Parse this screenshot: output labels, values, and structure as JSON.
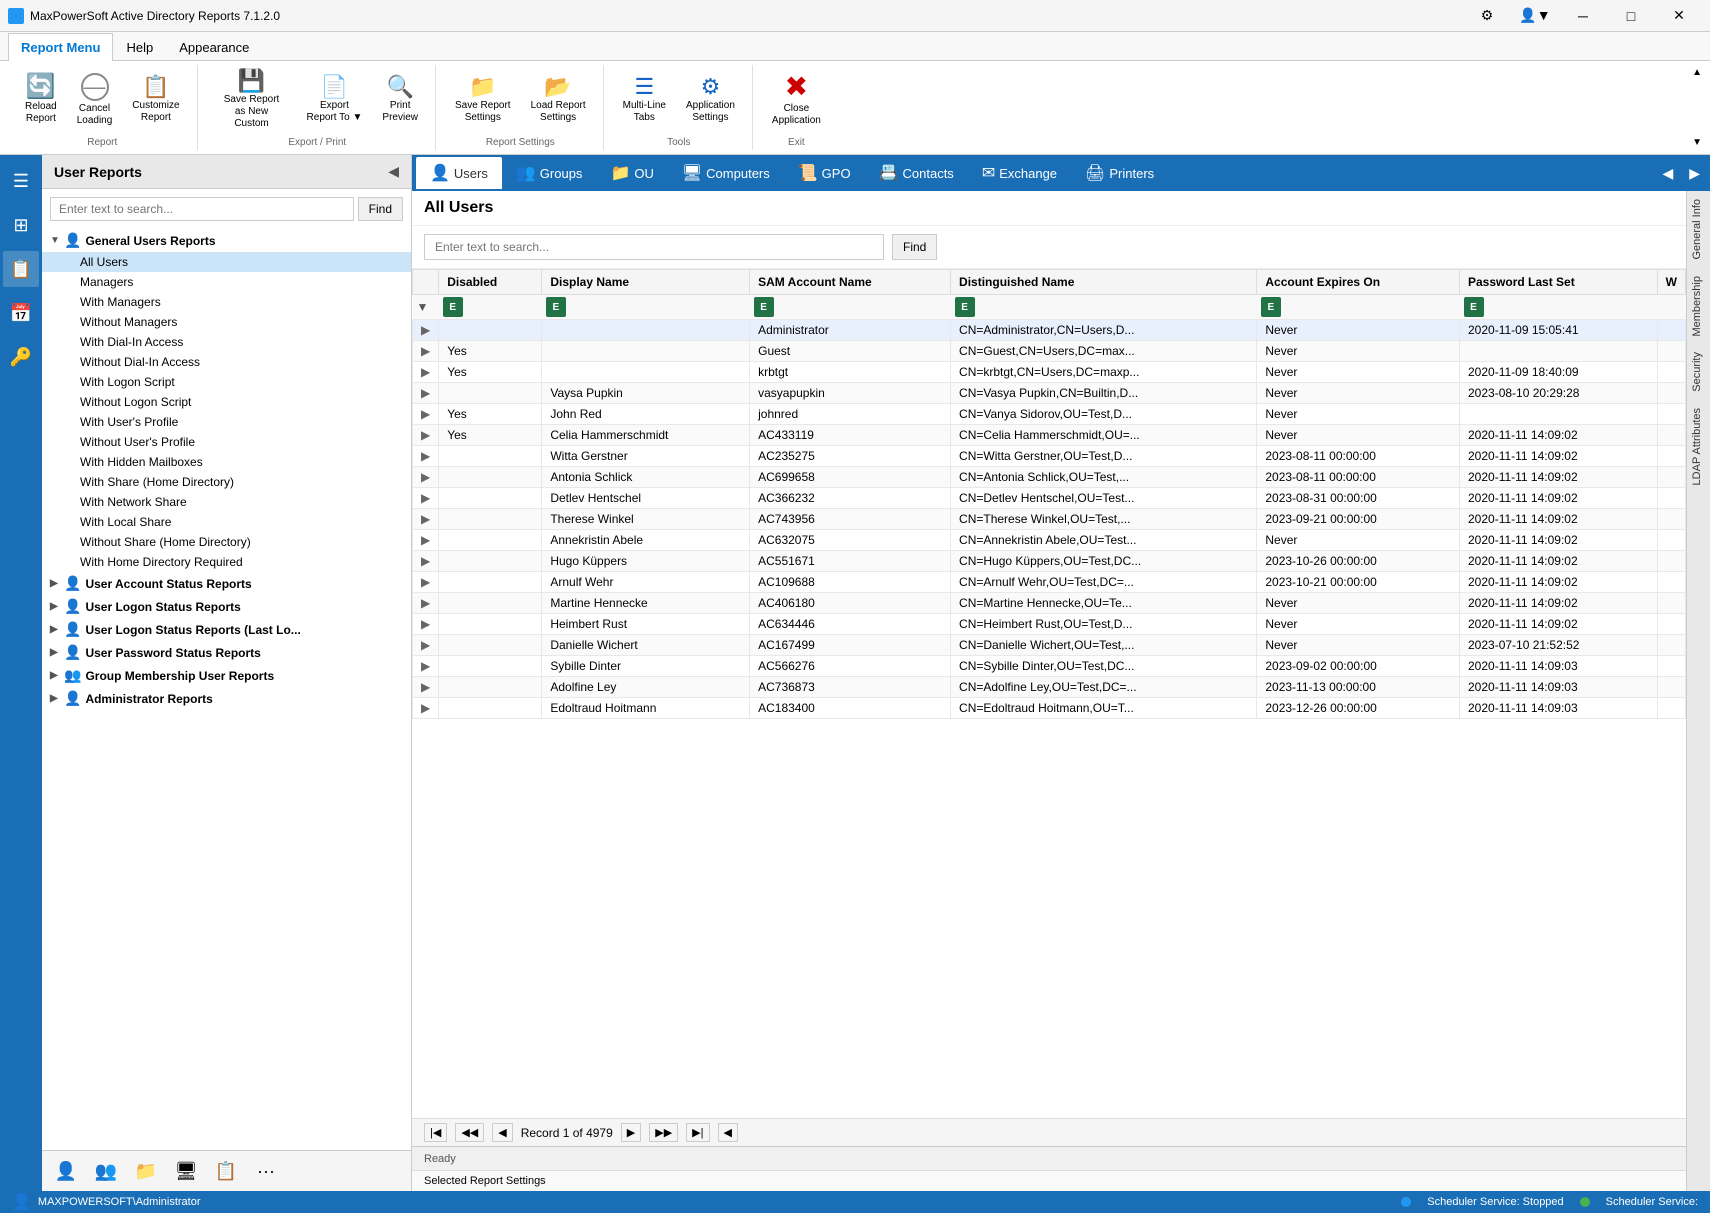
{
  "app": {
    "title": "MaxPowerSoft Active Directory Reports 7.1.2.0",
    "icon": "AD"
  },
  "titlebar": {
    "minimize": "─",
    "maximize": "□",
    "close": "✕",
    "settings_icon": "⚙",
    "user_icon": "👤"
  },
  "ribbon": {
    "tabs": [
      {
        "label": "Report Menu",
        "active": true
      },
      {
        "label": "Help",
        "active": false
      },
      {
        "label": "Appearance",
        "active": false
      }
    ],
    "groups": [
      {
        "label": "Report",
        "buttons": [
          {
            "icon": "🔄",
            "label": "Reload\nReport",
            "name": "reload-report"
          },
          {
            "icon": "⊖",
            "label": "Cancel\nLoading",
            "name": "cancel-loading"
          },
          {
            "icon": "📋",
            "label": "Customize\nReport",
            "name": "customize-report"
          }
        ]
      },
      {
        "label": "Export / Print",
        "buttons": [
          {
            "icon": "📄",
            "label": "Save Report\nas New Custom",
            "name": "save-report-new"
          },
          {
            "icon": "📑",
            "label": "Export\nReport To ▼",
            "name": "export-report"
          },
          {
            "icon": "🖨",
            "label": "Print\nPreview",
            "name": "print-preview"
          }
        ]
      },
      {
        "label": "Report Settings",
        "buttons": [
          {
            "icon": "💾",
            "label": "Save Report\nSettings",
            "name": "save-report-settings"
          },
          {
            "icon": "📂",
            "label": "Load Report\nSettings",
            "name": "load-report-settings"
          }
        ]
      },
      {
        "label": "Tools",
        "buttons": [
          {
            "icon": "☰",
            "label": "Multi-Line\nTabs",
            "name": "multi-line-tabs"
          },
          {
            "icon": "⚙",
            "label": "Application\nSettings",
            "name": "app-settings"
          }
        ]
      },
      {
        "label": "Exit",
        "buttons": [
          {
            "icon": "✖",
            "label": "Close\nApplication",
            "name": "close-application",
            "style": "red"
          }
        ]
      }
    ]
  },
  "left_panel": {
    "title": "User Reports",
    "search_placeholder": "Enter text to search...",
    "find_btn": "Find",
    "tree": [
      {
        "level": 1,
        "label": "General Users Reports",
        "icon": "👤",
        "expanded": true,
        "arrow": "▼"
      },
      {
        "level": 2,
        "label": "All Users",
        "icon": "",
        "selected": true
      },
      {
        "level": 2,
        "label": "Managers",
        "icon": ""
      },
      {
        "level": 2,
        "label": "With Managers",
        "icon": ""
      },
      {
        "level": 2,
        "label": "Without Managers",
        "icon": ""
      },
      {
        "level": 2,
        "label": "With Dial-In Access",
        "icon": ""
      },
      {
        "level": 2,
        "label": "Without Dial-In Access",
        "icon": ""
      },
      {
        "level": 2,
        "label": "With Logon Script",
        "icon": ""
      },
      {
        "level": 2,
        "label": "Without Logon Script",
        "icon": ""
      },
      {
        "level": 2,
        "label": "With User's Profile",
        "icon": ""
      },
      {
        "level": 2,
        "label": "Without User's Profile",
        "icon": ""
      },
      {
        "level": 2,
        "label": "With Hidden Mailboxes",
        "icon": ""
      },
      {
        "level": 2,
        "label": "With Share (Home Directory)",
        "icon": ""
      },
      {
        "level": 2,
        "label": "With Network Share",
        "icon": ""
      },
      {
        "level": 2,
        "label": "With Local Share",
        "icon": ""
      },
      {
        "level": 2,
        "label": "Without Share (Home Directory)",
        "icon": ""
      },
      {
        "level": 2,
        "label": "With Home Directory Required",
        "icon": ""
      },
      {
        "level": 1,
        "label": "User Account Status Reports",
        "icon": "👤",
        "expanded": false,
        "arrow": "▶"
      },
      {
        "level": 1,
        "label": "User Logon Status Reports",
        "icon": "👤",
        "expanded": false,
        "arrow": "▶"
      },
      {
        "level": 1,
        "label": "User Logon Status Reports (Last Lo...",
        "icon": "👤",
        "expanded": false,
        "arrow": "▶"
      },
      {
        "level": 1,
        "label": "User Password Status Reports",
        "icon": "👤",
        "expanded": false,
        "arrow": "▶"
      },
      {
        "level": 1,
        "label": "Group Membership User Reports",
        "icon": "👥",
        "expanded": false,
        "arrow": "▶"
      },
      {
        "level": 1,
        "label": "Administrator Reports",
        "icon": "👤",
        "expanded": false,
        "arrow": "▶"
      }
    ],
    "bottom_icons": [
      "👤",
      "👥",
      "📁",
      "🖥",
      "📋",
      "..."
    ]
  },
  "tabs": [
    {
      "label": "Users",
      "icon": "👤",
      "active": true
    },
    {
      "label": "Groups",
      "icon": "👥",
      "active": false
    },
    {
      "label": "OU",
      "icon": "📁",
      "active": false
    },
    {
      "label": "Computers",
      "icon": "🖥",
      "active": false
    },
    {
      "label": "GPO",
      "icon": "📜",
      "active": false
    },
    {
      "label": "Contacts",
      "icon": "📇",
      "active": false
    },
    {
      "label": "Exchange",
      "icon": "✉",
      "active": false
    },
    {
      "label": "Printers",
      "icon": "🖨",
      "active": false
    }
  ],
  "content": {
    "title": "All Users",
    "search_placeholder": "Enter text to search...",
    "find_btn": "Find",
    "columns": [
      "Disabled",
      "Display Name",
      "SAM Account Name",
      "Distinguished Name",
      "Account Expires On",
      "Password Last Set",
      "W"
    ],
    "rows": [
      {
        "disabled": "",
        "display_name": "",
        "sam": "Administrator",
        "dn": "CN=Administrator,CN=Users,D...",
        "expires": "Never",
        "pwd_last": "2020-11-09 15:05:41"
      },
      {
        "disabled": "Yes",
        "display_name": "",
        "sam": "Guest",
        "dn": "CN=Guest,CN=Users,DC=max...",
        "expires": "Never",
        "pwd_last": ""
      },
      {
        "disabled": "Yes",
        "display_name": "",
        "sam": "krbtgt",
        "dn": "CN=krbtgt,CN=Users,DC=maxp...",
        "expires": "Never",
        "pwd_last": "2020-11-09 18:40:09"
      },
      {
        "disabled": "",
        "display_name": "Vaysa Pupkin",
        "sam": "vasyapupkin",
        "dn": "CN=Vasya Pupkin,CN=Builtin,D...",
        "expires": "Never",
        "pwd_last": "2023-08-10 20:29:28"
      },
      {
        "disabled": "Yes",
        "display_name": "John Red",
        "sam": "johnred",
        "dn": "CN=Vanya Sidorov,OU=Test,D...",
        "expires": "Never",
        "pwd_last": ""
      },
      {
        "disabled": "Yes",
        "display_name": "Celia Hammerschmidt",
        "sam": "AC433119",
        "dn": "CN=Celia Hammerschmidt,OU=...",
        "expires": "Never",
        "pwd_last": "2020-11-11 14:09:02"
      },
      {
        "disabled": "",
        "display_name": "Witta Gerstner",
        "sam": "AC235275",
        "dn": "CN=Witta Gerstner,OU=Test,D...",
        "expires": "2023-08-11 00:00:00",
        "pwd_last": "2020-11-11 14:09:02"
      },
      {
        "disabled": "",
        "display_name": "Antonia Schlick",
        "sam": "AC699658",
        "dn": "CN=Antonia Schlick,OU=Test,...",
        "expires": "2023-08-11 00:00:00",
        "pwd_last": "2020-11-11 14:09:02"
      },
      {
        "disabled": "",
        "display_name": "Detlev Hentschel",
        "sam": "AC366232",
        "dn": "CN=Detlev Hentschel,OU=Test...",
        "expires": "2023-08-31 00:00:00",
        "pwd_last": "2020-11-11 14:09:02"
      },
      {
        "disabled": "",
        "display_name": "Therese Winkel",
        "sam": "AC743956",
        "dn": "CN=Therese Winkel,OU=Test,...",
        "expires": "2023-09-21 00:00:00",
        "pwd_last": "2020-11-11 14:09:02"
      },
      {
        "disabled": "",
        "display_name": "Annekristin Abele",
        "sam": "AC632075",
        "dn": "CN=Annekristin Abele,OU=Test...",
        "expires": "Never",
        "pwd_last": "2020-11-11 14:09:02"
      },
      {
        "disabled": "",
        "display_name": "Hugo Küppers",
        "sam": "AC551671",
        "dn": "CN=Hugo Küppers,OU=Test,DC...",
        "expires": "2023-10-26 00:00:00",
        "pwd_last": "2020-11-11 14:09:02"
      },
      {
        "disabled": "",
        "display_name": "Arnulf Wehr",
        "sam": "AC109688",
        "dn": "CN=Arnulf Wehr,OU=Test,DC=...",
        "expires": "2023-10-21 00:00:00",
        "pwd_last": "2020-11-11 14:09:02"
      },
      {
        "disabled": "",
        "display_name": "Martine Hennecke",
        "sam": "AC406180",
        "dn": "CN=Martine Hennecke,OU=Te...",
        "expires": "Never",
        "pwd_last": "2020-11-11 14:09:02"
      },
      {
        "disabled": "",
        "display_name": "Heimbert Rust",
        "sam": "AC634446",
        "dn": "CN=Heimbert Rust,OU=Test,D...",
        "expires": "Never",
        "pwd_last": "2020-11-11 14:09:02"
      },
      {
        "disabled": "",
        "display_name": "Danielle Wichert",
        "sam": "AC167499",
        "dn": "CN=Danielle Wichert,OU=Test,...",
        "expires": "Never",
        "pwd_last": "2023-07-10 21:52:52"
      },
      {
        "disabled": "",
        "display_name": "Sybille Dinter",
        "sam": "AC566276",
        "dn": "CN=Sybille Dinter,OU=Test,DC...",
        "expires": "2023-09-02 00:00:00",
        "pwd_last": "2020-11-11 14:09:03"
      },
      {
        "disabled": "",
        "display_name": "Adolfine Ley",
        "sam": "AC736873",
        "dn": "CN=Adolfine Ley,OU=Test,DC=...",
        "expires": "2023-11-13 00:00:00",
        "pwd_last": "2020-11-11 14:09:03"
      },
      {
        "disabled": "",
        "display_name": "Edoltraud Hoitmann",
        "sam": "AC183400",
        "dn": "CN=Edoltraud Hoitmann,OU=T...",
        "expires": "2023-12-26 00:00:00",
        "pwd_last": "2020-11-11 14:09:03"
      }
    ],
    "nav": {
      "record_info": "Record 1 of 4979"
    }
  },
  "right_sidepanels": [
    "General Info",
    "Membership",
    "Security",
    "LDAP Attributes"
  ],
  "status": {
    "ready": "Ready",
    "selected_settings": "Selected Report Settings"
  },
  "bottom_status": {
    "user": "MAXPOWERSOFT\\Administrator",
    "scheduler1": "Scheduler Service: Stopped",
    "scheduler2": "Scheduler Service:"
  }
}
